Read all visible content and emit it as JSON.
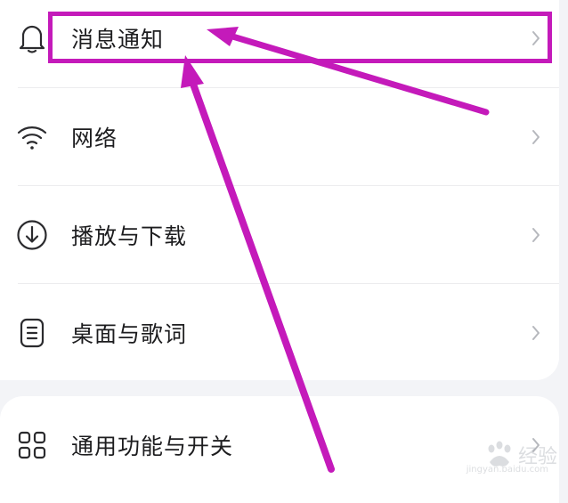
{
  "settings": {
    "items": [
      {
        "label": "消息通知",
        "icon": "bell-icon"
      },
      {
        "label": "网络",
        "icon": "wifi-icon"
      },
      {
        "label": "播放与下载",
        "icon": "download-icon"
      },
      {
        "label": "桌面与歌词",
        "icon": "lyrics-document-icon"
      },
      {
        "label": "通用功能与开关",
        "icon": "grid-icon"
      }
    ]
  },
  "annotation": {
    "color": "#c41aba",
    "highlighted_item": "消息通知"
  },
  "watermark": {
    "text": "经验",
    "url": "jingyan.baidu.com"
  }
}
